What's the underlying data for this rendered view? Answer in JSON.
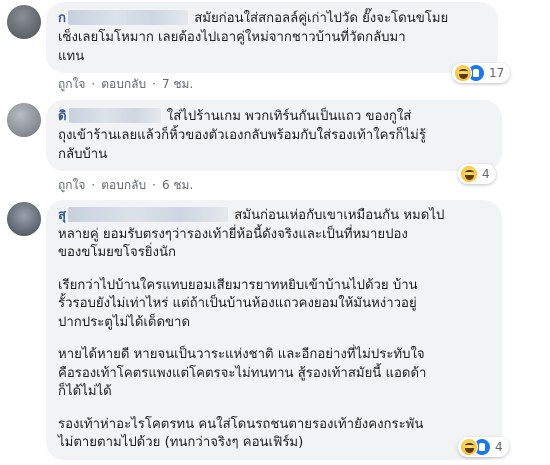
{
  "actions": {
    "like": "ถูกใจ",
    "reply": "ตอบกลับ",
    "separator": "·"
  },
  "comments": [
    {
      "name": "ก",
      "text_lines": [
        "สมัยก่อนใส่สกอลล์คู่เก่าไปวัด ยั๊งจะโดนขโมย",
        "เซ็งเลยโมโหมาก เลยต้องไปเอาคู่ใหม่จากชาวบ้านที่วัดกลับมา",
        "แทน"
      ],
      "time": "7 ชม.",
      "reactions": [
        "haha-icon",
        "like-icon"
      ],
      "reaction_count": "17"
    },
    {
      "name": "ดิ",
      "text_lines": [
        "ใส่ไปร้านเกม พวกเทิร์นกันเป็นแถว ของกูใส่",
        "ถุงเข้าร้านเลยแล้วก็หิ้วของตัวเองกลับพร้อมกับใส่รองเท้าใครก็ไม่รู้",
        "กลับบ้าน"
      ],
      "time": "6 ชม.",
      "reactions": [
        "haha-icon"
      ],
      "reaction_count": "4"
    },
    {
      "name": "สุ",
      "paragraphs": [
        [
          "สมันก่อนเห่อกับเขาเหมือนกัน หมดไป",
          "หลายคู่ ยอมรับตรงๆว่ารองเท้ายี่ห้อนี้ดังจริงและเป็นที่หมายปอง",
          "ของขโมยขโจรยิ่งนัก"
        ],
        [
          "เรียกว่าไปบ้านใครแทบยอมเสียมารยาทหยิบเข้าบ้านไปด้วย บ้าน",
          "รั้วรอบยังไม่เท่าไหร่ แต่ถ้าเป็นบ้านห้องแถวคงยอมให้มันหง่าวอยู่",
          "ปากประตูไม่ได้เด็ดขาด"
        ],
        [
          "หายได้หายดี หายจนเป็นวาระแห่งชาติ และอีกอย่างที่ไม่ประทับใจ",
          "คือรองเท้าโคตรแพงแต่โคตรจะไม่ทนทาน สู้รองเท้าสมัยนี้ แอดด้า",
          "ก็ได้ไม่ได้"
        ],
        [
          "รองเท้าห่าอะไรโคตรทน คนใส่โดนรถชนตายรองเท้ายังคงกระพัน",
          "ไม่ตายตามไปด้วย (ทนกว่าจริงๆ คอนเฟิร์ม)"
        ]
      ],
      "reactions": [
        "haha-icon",
        "like-icon"
      ],
      "reaction_count": "4"
    }
  ]
}
